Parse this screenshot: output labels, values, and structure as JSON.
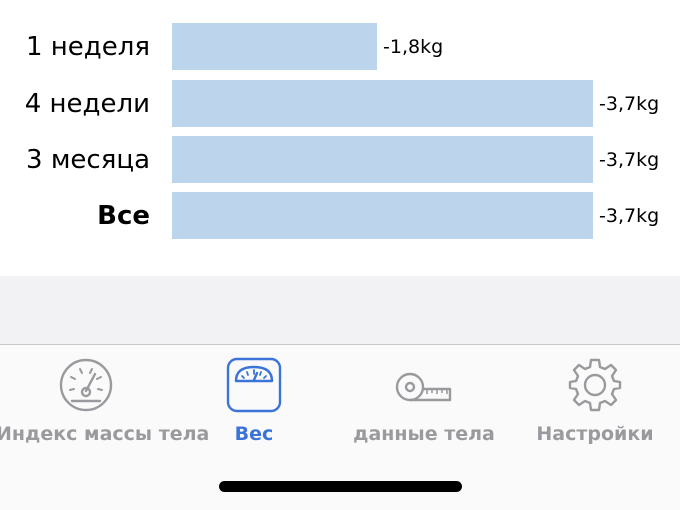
{
  "summary": {
    "rows": [
      {
        "label": "1 неделя",
        "value": "-1,8kg",
        "fraction": 0.487,
        "bold": false
      },
      {
        "label": "4 недели",
        "value": "-3,7kg",
        "fraction": 1.0,
        "bold": false
      },
      {
        "label": "3 месяца",
        "value": "-3,7kg",
        "fraction": 1.0,
        "bold": false
      },
      {
        "label": "Все",
        "value": "-3,7kg",
        "fraction": 1.0,
        "bold": true
      }
    ],
    "bar_color": "#bcd4ec"
  },
  "tabbar": {
    "accent": "#3a74d8",
    "inactive": "#9a9a9e",
    "tabs": [
      {
        "label": "Индекс массы тела",
        "icon": "gauge-icon",
        "active": false
      },
      {
        "label": "Вес",
        "icon": "scale-icon",
        "active": true
      },
      {
        "label": "данные тела",
        "icon": "tape-measure-icon",
        "active": false
      },
      {
        "label": "Настройки",
        "icon": "gear-icon",
        "active": false
      }
    ]
  }
}
